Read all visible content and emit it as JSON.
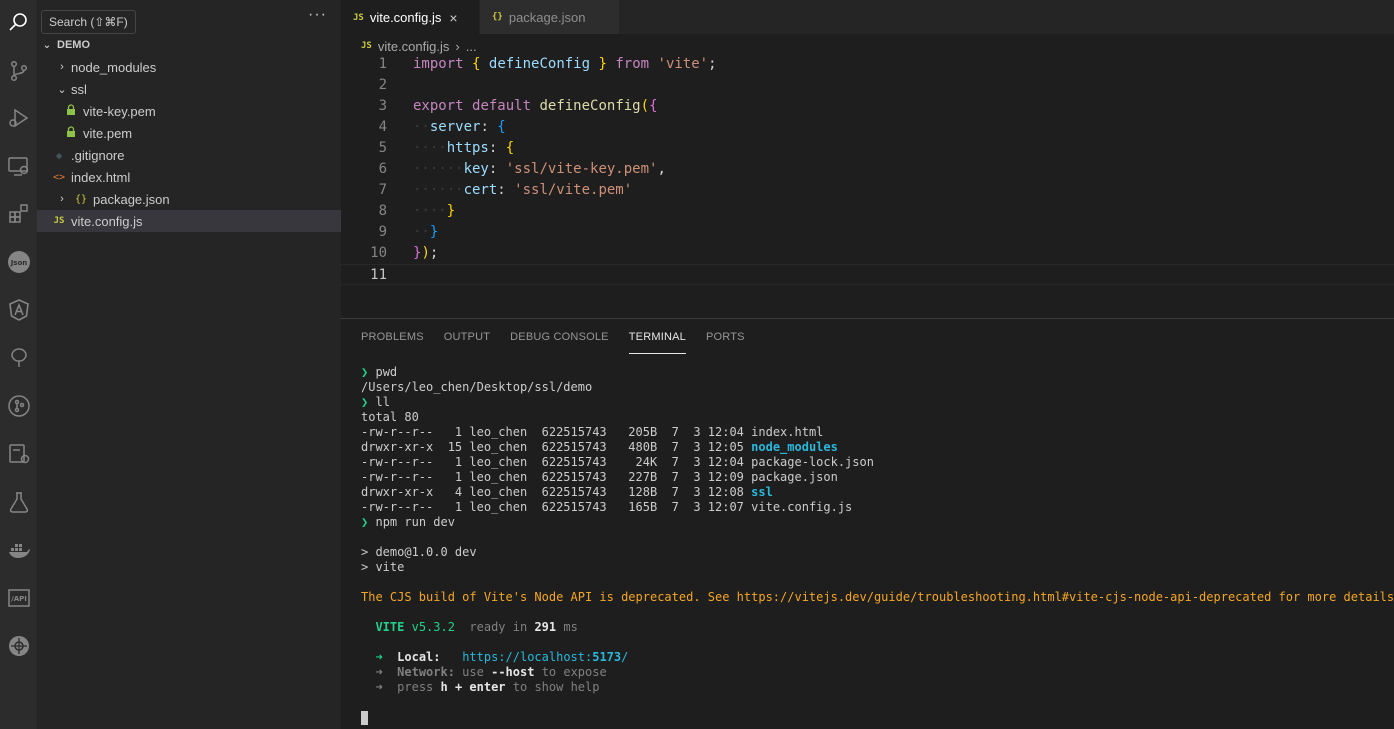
{
  "tooltip": "Search (⇧⌘F)",
  "sidebar": {
    "folder_name": "DEMO",
    "more": "···",
    "items": [
      {
        "label": "node_modules",
        "chev": "›",
        "icon": ""
      },
      {
        "label": "ssl",
        "chev": "⌄",
        "icon": ""
      },
      {
        "label": "vite-key.pem",
        "chev": "",
        "icon": "lock"
      },
      {
        "label": "vite.pem",
        "chev": "",
        "icon": "lock"
      },
      {
        "label": ".gitignore",
        "chev": "",
        "icon": "◆"
      },
      {
        "label": "index.html",
        "chev": "",
        "icon": "<>"
      },
      {
        "label": "package.json",
        "chev": "›",
        "icon": "{}"
      },
      {
        "label": "vite.config.js",
        "chev": "",
        "icon": "JS"
      }
    ]
  },
  "tabs": [
    {
      "label": "vite.config.js",
      "icon": "JS",
      "close": "×"
    },
    {
      "label": "package.json",
      "icon": "{}"
    }
  ],
  "breadcrumb": {
    "icon": "JS",
    "file": "vite.config.js",
    "sep": "›",
    "tail": "..."
  },
  "code": {
    "line_numbers": [
      "1",
      "2",
      "3",
      "4",
      "5",
      "6",
      "7",
      "8",
      "9",
      "10",
      "11"
    ]
  },
  "panel": {
    "tabs": [
      "PROBLEMS",
      "OUTPUT",
      "DEBUG CONSOLE",
      "TERMINAL",
      "PORTS"
    ],
    "active_tab": "TERMINAL"
  },
  "terminal": {
    "prompt_symbol": "❯",
    "cmd1": "pwd",
    "pwd_out": "/Users/leo_chen/Desktop/ssl/demo",
    "cmd2": "ll",
    "total": "total 80",
    "ls_rows": [
      {
        "meta": "-rw-r--r--   1 leo_chen  622515743   205B  7  3 12:04 ",
        "name": "index.html",
        "dir": false
      },
      {
        "meta": "drwxr-xr-x  15 leo_chen  622515743   480B  7  3 12:05 ",
        "name": "node_modules",
        "dir": true
      },
      {
        "meta": "-rw-r--r--   1 leo_chen  622515743    24K  7  3 12:04 ",
        "name": "package-lock.json",
        "dir": false
      },
      {
        "meta": "-rw-r--r--   1 leo_chen  622515743   227B  7  3 12:09 ",
        "name": "package.json",
        "dir": false
      },
      {
        "meta": "drwxr-xr-x   4 leo_chen  622515743   128B  7  3 12:08 ",
        "name": "ssl",
        "dir": true
      },
      {
        "meta": "-rw-r--r--   1 leo_chen  622515743   165B  7  3 12:07 ",
        "name": "vite.config.js",
        "dir": false
      }
    ],
    "cmd3": "npm run dev",
    "npm1": "> demo@1.0.0 dev",
    "npm2": "> vite",
    "warning": "The CJS build of Vite's Node API is deprecated. See https://vitejs.dev/guide/troubleshooting.html#vite-cjs-node-api-deprecated for more details.",
    "vite_name": "VITE",
    "vite_version": "v5.3.2",
    "ready_text": "ready in",
    "ready_ms": "291",
    "ms": "ms",
    "arrow": "➜",
    "local_label": "Local:",
    "local_url_pre": "https://localhost:",
    "local_port": "5173",
    "local_url_post": "/",
    "network_label": "Network:",
    "network_use": "use",
    "network_flag": "--host",
    "network_rest": "to expose",
    "help_press": "press",
    "help_keys": "h + enter",
    "help_rest": "to show help"
  },
  "colors": {
    "accent_green": "#23d18b",
    "warning": "#f5a623",
    "dir": "#29b8db"
  }
}
